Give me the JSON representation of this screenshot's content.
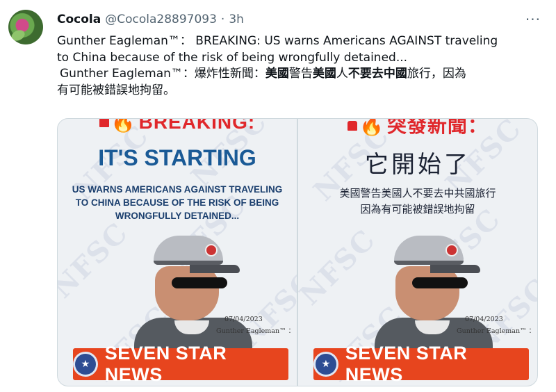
{
  "tweet": {
    "display_name": "Cocola",
    "handle": "@Cocola28897093",
    "separator": "·",
    "time": "3h",
    "more_icon": "more-horizontal-icon",
    "text_line1": "Gunther Eagleman™： BREAKING: US warns Americans AGAINST traveling",
    "text_line2": "to China because of the risk of being wrongfully detained...",
    "text_zh_pre": "Gunther Eagleman™：爆炸性新聞：",
    "text_zh_b1": "美國",
    "text_zh_m1": "警告",
    "text_zh_b2": "美國",
    "text_zh_m2": "人",
    "text_zh_b3": "不要去中國",
    "text_zh_m3": "旅行，因為",
    "text_zh_line2": "有可能被錯誤地拘留。"
  },
  "media": {
    "left": {
      "breaking": "BREAKING:",
      "headline": "IT'S STARTING",
      "sub_line1": "US WARNS AMERICANS AGAINST TRAVELING",
      "sub_line2": "TO CHINA BECAUSE OF THE RISK OF BEING",
      "sub_line3": "WRONGFULLY DETAINED...",
      "date": "07/04/2023",
      "author": "Gunther Eagleman™ ：",
      "banner": "SEVEN STAR NEWS"
    },
    "right": {
      "breaking": "突發新聞：",
      "headline": "它開始了",
      "sub_line1": "美國警告美國人不要去中共國旅行",
      "sub_line2": "因為有可能被錯誤地拘留",
      "date": "07/04/2023",
      "author": "Gunther Eagleman™ ：",
      "banner": "SEVEN STAR NEWS"
    },
    "watermark": "NFSC"
  },
  "colors": {
    "banner": "#e7451e",
    "breaking": "#e0272b",
    "headline_en": "#1a5a96"
  }
}
